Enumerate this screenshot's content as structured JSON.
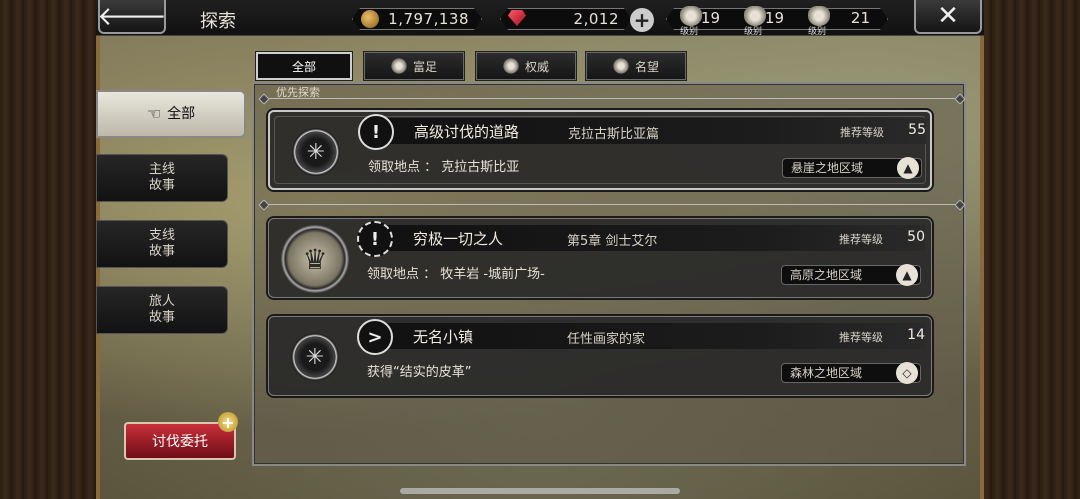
{
  "header": {
    "title": "探索",
    "back_icon": "left-arrow-icon",
    "close_icon": "close-x-icon",
    "currency_gold": "1,797,138",
    "currency_gem": "2,012",
    "plus_label": "+",
    "ranks": [
      {
        "label": "级别",
        "value": "19",
        "icon": "rank-wealth-icon"
      },
      {
        "label": "级别",
        "value": "19",
        "icon": "rank-power-icon"
      },
      {
        "label": "级别",
        "value": "21",
        "icon": "rank-fame-icon"
      }
    ]
  },
  "filter_tabs": [
    {
      "label": "全部",
      "active": true
    },
    {
      "label": "富足",
      "icon": "wealth-icon"
    },
    {
      "label": "权威",
      "icon": "power-icon"
    },
    {
      "label": "名望",
      "icon": "fame-icon"
    }
  ],
  "side_tabs": [
    {
      "label": "全部",
      "active": true,
      "icon": "pointing-hand-icon"
    },
    {
      "label": "主线\n故事"
    },
    {
      "label": "支线\n故事"
    },
    {
      "label": "旅人\n故事"
    }
  ],
  "request_button": {
    "label": "讨伐委托",
    "badge": "+"
  },
  "section_label": "优先探索",
  "quests": [
    {
      "badge": "!",
      "title": "高级讨伐的道路",
      "subtitle": "克拉古斯比亚篇",
      "level_label": "推荐等级",
      "level": "55",
      "location": "领取地点 ： 克拉古斯比亚",
      "region": "悬崖之地区域",
      "region_icon": "mountain-icon"
    },
    {
      "badge": "!",
      "title": "穷极一切之人",
      "subtitle": "第5章  剑士艾尔",
      "level_label": "推荐等级",
      "level": "50",
      "location": "领取地点 ： 牧羊岩 -城前广场-",
      "region": "高原之地区域",
      "region_icon": "mountain-icon"
    },
    {
      "badge": ">",
      "title": "无名小镇",
      "subtitle": "任性画家的家",
      "level_label": "推荐等级",
      "level": "14",
      "location": "获得“结实的皮革”",
      "region": "森林之地区域",
      "region_icon": "diamond-icon"
    }
  ]
}
